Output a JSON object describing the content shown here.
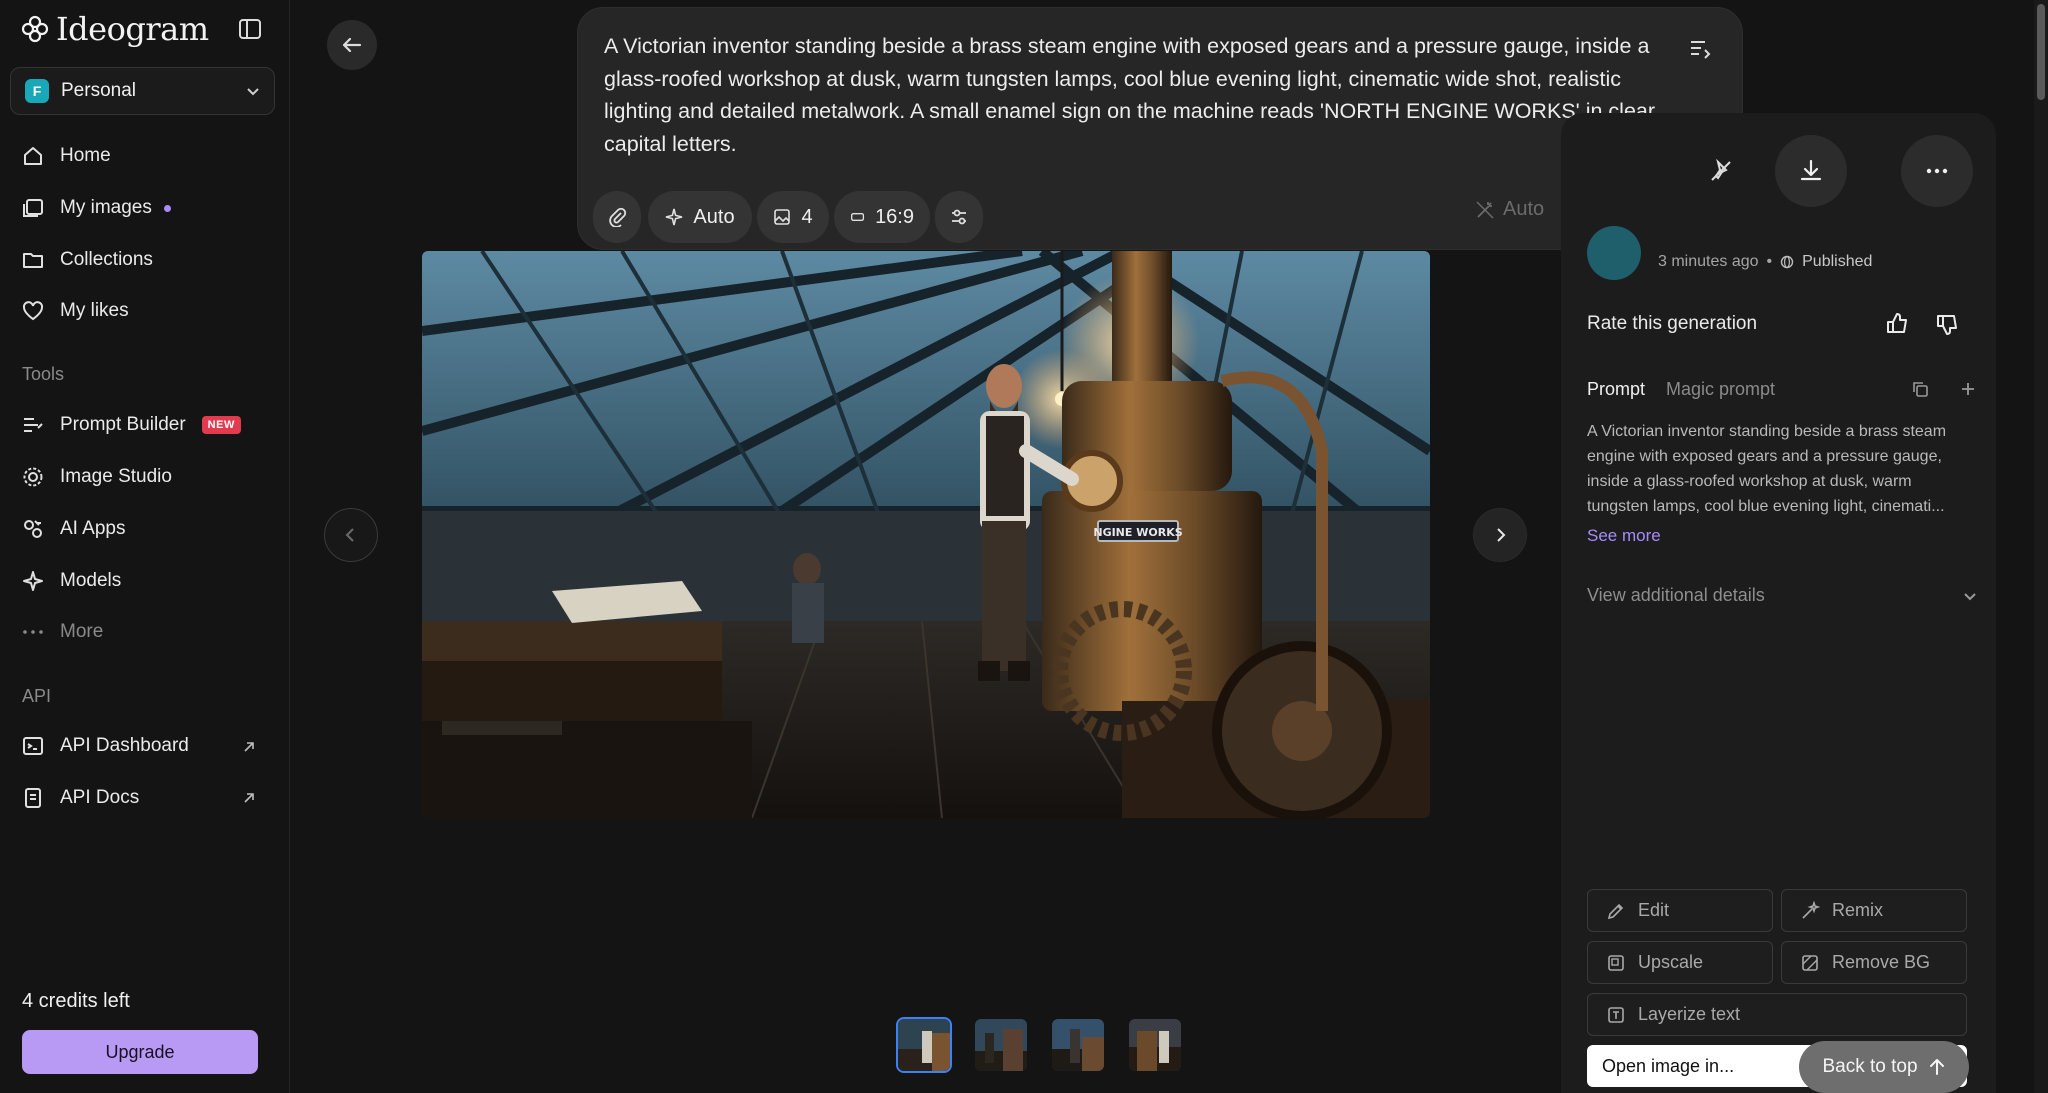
{
  "app": {
    "name": "Ideogram"
  },
  "workspace": {
    "initial": "F",
    "name": "Personal"
  },
  "nav": {
    "home": "Home",
    "my_images": "My images",
    "collections": "Collections",
    "my_likes": "My likes"
  },
  "tools": {
    "section": "Tools",
    "prompt_builder": "Prompt Builder",
    "new_badge": "NEW",
    "image_studio": "Image Studio",
    "ai_apps": "AI Apps",
    "models": "Models",
    "more": "More"
  },
  "api": {
    "section": "API",
    "dashboard": "API Dashboard",
    "docs": "API Docs"
  },
  "account": {
    "credits": "4 credits left",
    "upgrade": "Upgrade"
  },
  "prompt": {
    "text": "A Victorian inventor standing beside a brass steam engine with exposed gears and a pressure gauge, inside a glass-roofed workshop at dusk, warm tungsten lamps, cool blue evening light, cinematic wide shot, realistic lighting and detailed metalwork. A small enamel sign on the machine reads 'NORTH ENGINE WORKS' in clear capital letters.",
    "mode": "Auto",
    "count": "4",
    "aspect": "16:9",
    "magic": "Auto"
  },
  "image": {
    "sign_text": "NGINE WORKS"
  },
  "details": {
    "time_ago": "3 minutes ago",
    "bullet": "•",
    "visibility": "Published",
    "rate": "Rate this generation",
    "tab_prompt": "Prompt",
    "tab_magic": "Magic prompt",
    "prompt_preview": "A Victorian inventor standing beside a brass steam engine with exposed gears and a pressure gauge, inside a glass-roofed workshop at dusk, warm tungsten lamps, cool blue evening light, cinemati...",
    "see_more": "See more",
    "additional": "View additional details"
  },
  "actions": {
    "edit": "Edit",
    "remix": "Remix",
    "upscale": "Upscale",
    "remove_bg": "Remove BG",
    "layerize": "Layerize text",
    "open_in": "Open image in...",
    "back_to_top": "Back to top"
  },
  "colors": {
    "accent": "#a78bfa",
    "upgrade": "#b89af5",
    "new_badge": "#e23b4f",
    "workspace_avatar": "#1aa8b8",
    "thumb_active": "#3b82f6"
  }
}
